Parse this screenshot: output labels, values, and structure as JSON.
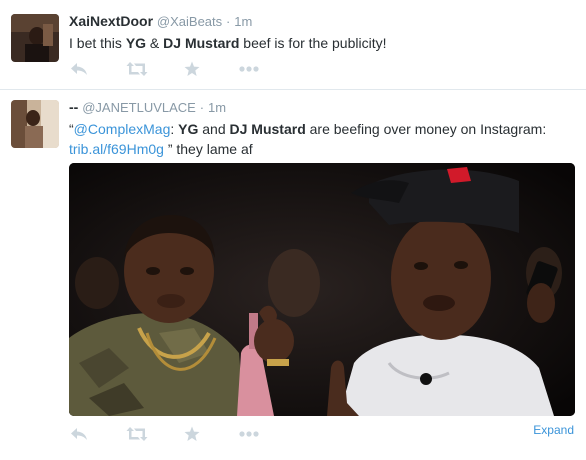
{
  "tweets": [
    {
      "fullname": "XaiNextDoor",
      "username": "@XaiBeats",
      "separator": "·",
      "time": "1m",
      "text": {
        "p1": "I bet this ",
        "b1": "YG",
        "p2": " & ",
        "b2": "DJ Mustard",
        "p3": " beef is for the publicity!"
      }
    },
    {
      "fullname": "--",
      "username": "@JANETLUVLACE",
      "separator": "·",
      "time": "1m",
      "text": {
        "q_open": "“",
        "mention": "@ComplexMag",
        "p1": ": ",
        "b1": "YG",
        "p2": " and ",
        "b2": "DJ Mustard",
        "p3": " are beefing over money on Instagram: ",
        "link": "trib.al/f69Hm0g",
        "p4": " ” they lame af"
      },
      "expand_label": "Expand"
    }
  ],
  "icons": {
    "reply": "reply-icon",
    "retweet": "retweet-icon",
    "favorite": "star-icon",
    "more": "more-dots-icon"
  },
  "colors": {
    "link": "#3b94d9",
    "meta_gray": "#8899a6",
    "action_gray": "#ccd6dd",
    "text": "#292f33"
  }
}
